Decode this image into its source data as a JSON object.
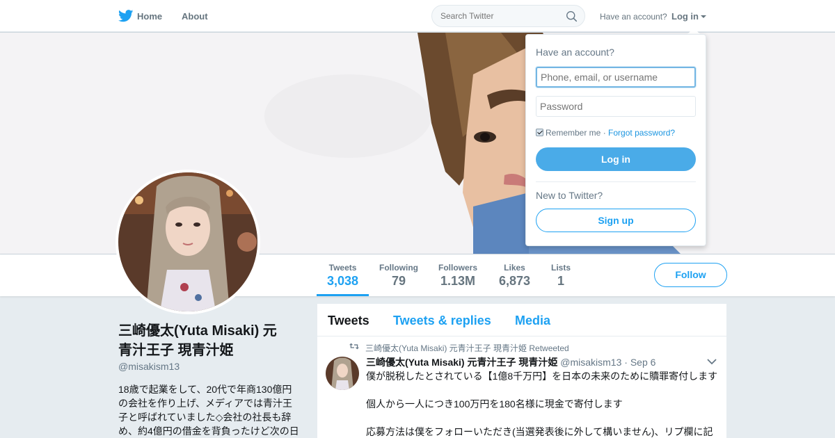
{
  "nav": {
    "home_label": "Home",
    "about_label": "About",
    "search_placeholder": "Search Twitter",
    "have_account": "Have an account?",
    "login_label": "Log in"
  },
  "login_dropdown": {
    "title": "Have an account?",
    "username_placeholder": "Phone, email, or username",
    "password_placeholder": "Password",
    "remember_me": "Remember me",
    "separator": "·",
    "forgot_password": "Forgot password?",
    "login_button": "Log in",
    "new_to_twitter": "New to Twitter?",
    "signup_button": "Sign up"
  },
  "stats": [
    {
      "label": "Tweets",
      "value": "3,038"
    },
    {
      "label": "Following",
      "value": "79"
    },
    {
      "label": "Followers",
      "value": "1.13M"
    },
    {
      "label": "Likes",
      "value": "6,873"
    },
    {
      "label": "Lists",
      "value": "1"
    }
  ],
  "follow_button": "Follow",
  "profile": {
    "name_line1": "三崎優太(Yuta Misaki) 元",
    "name_line2": "青汁王子 現青汁姫",
    "handle": "@misakism13",
    "bio_lines": [
      "18歳で起業をして、20代で年商130億円",
      "の会社を作り上げ、メディアでは青汁王",
      "子と呼ばれていました◇会社の社長も辞",
      "め、約4億円の借金を背負ったけど次の日"
    ]
  },
  "timeline": {
    "tabs": [
      "Tweets",
      "Tweets & replies",
      "Media"
    ],
    "retweet_context": "三崎優太(Yuta Misaki) 元青汁王子 現青汁姫 Retweeted",
    "tweet": {
      "name": "三崎優太(Yuta Misaki) 元青汁王子 現青汁姫",
      "handle": "@misakism13",
      "dot": "·",
      "time": "Sep 6",
      "lines": [
        "僕が脱税したとされている【1億8千万円】を日本の未来のために贖罪寄付します",
        "個人から一人につき100万円を180名様に現金で寄付します",
        "応募方法は僕をフォローいただき(当選発表後に外して構いません)、リプ欄に記"
      ]
    }
  },
  "colors": {
    "brand": "#1da1f2",
    "login_button": "#4aabe8",
    "background": "#e6ecf0"
  }
}
